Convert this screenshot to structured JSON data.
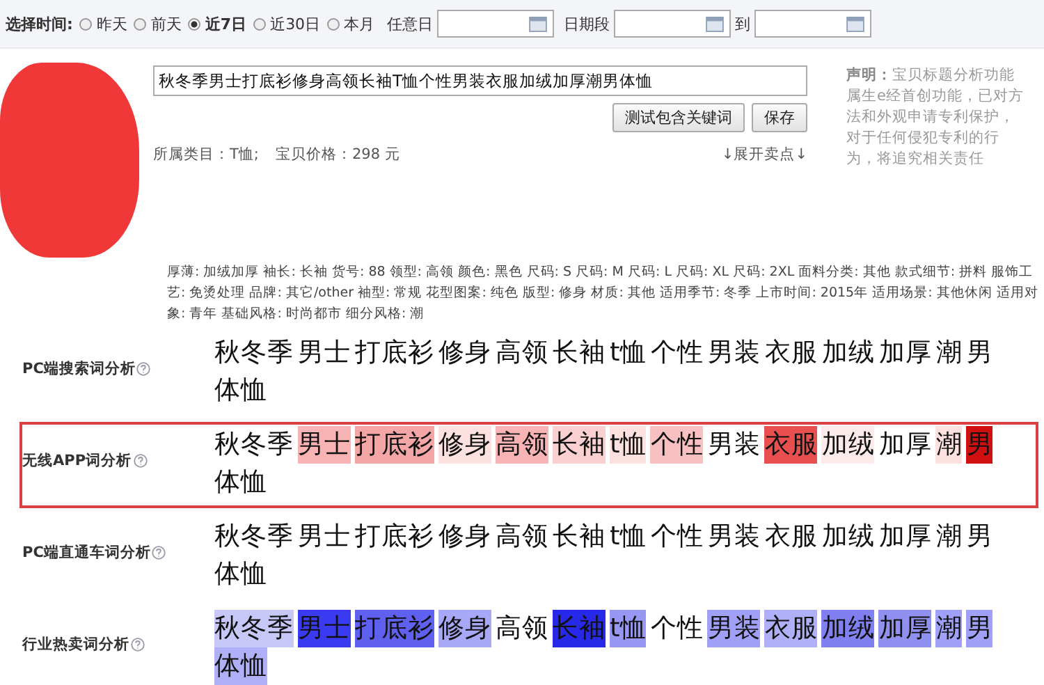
{
  "time_filter": {
    "label": "选择时间:",
    "options": [
      {
        "label": "昨天",
        "selected": false
      },
      {
        "label": "前天",
        "selected": false
      },
      {
        "label": "近7日",
        "selected": true
      },
      {
        "label": "近30日",
        "selected": false
      },
      {
        "label": "本月",
        "selected": false
      }
    ],
    "any_day_label": "任意日",
    "range_label": "日期段",
    "to_label": "到"
  },
  "product": {
    "title": "秋冬季男士打底衫修身高领长袖T恤个性男装衣服加绒加厚潮男体恤",
    "buttons": [
      "测试包含关键词",
      "保存"
    ],
    "category": "所属类目：T恤;",
    "price": "宝贝价格：298 元",
    "expand_link": "↓展开卖点↓",
    "notice_label": "声明：",
    "notice": "宝贝标题分析功能属生e经首创功能，已对方法和外观申请专利保护，对于任何侵犯专利的行为，将追究相关责任",
    "attributes": "厚薄: 加绒加厚  袖长: 长袖  货号: 88  领型: 高领  颜色: 黑色  尺码: S  尺码: M  尺码: L  尺码: XL  尺码: 2XL  面料分类: 其他  款式细节: 拼料  服饰工艺: 免烫处理  品牌: 其它/other  袖型: 常规  花型图案: 纯色  版型: 修身  材质: 其他  适用季节: 冬季  上市时间: 2015年  适用场景: 其他休闲  适用对象: 青年  基础风格: 时尚都市  细分风格: 潮"
  },
  "analysis_rows": [
    {
      "label": "PC端搜索词分析",
      "selected": false,
      "tokens": [
        {
          "text": "秋冬季"
        },
        {
          "text": "男士"
        },
        {
          "text": "打底衫"
        },
        {
          "text": "修身"
        },
        {
          "text": "高领"
        },
        {
          "text": "长袖"
        },
        {
          "text": "t恤"
        },
        {
          "text": "个性"
        },
        {
          "text": "男装"
        },
        {
          "text": "衣服"
        },
        {
          "text": "加绒"
        },
        {
          "text": "加厚"
        },
        {
          "text": "潮"
        },
        {
          "text": "男"
        },
        {
          "text": "体恤"
        }
      ]
    },
    {
      "label": "无线APP词分析",
      "selected": true,
      "tokens": [
        {
          "text": "秋冬季"
        },
        {
          "text": "男士",
          "color": "#f8b4b4"
        },
        {
          "text": "打底衫",
          "color": "#f4a6a6"
        },
        {
          "text": "修身",
          "color": "#fde0e0"
        },
        {
          "text": "高领",
          "color": "#f8b4b4"
        },
        {
          "text": "长袖",
          "color": "#fbd0d0"
        },
        {
          "text": "t恤",
          "color": "#fde0e0"
        },
        {
          "text": "个性",
          "color": "#f8c0c0"
        },
        {
          "text": "男装"
        },
        {
          "text": "衣服",
          "color": "#e85050"
        },
        {
          "text": "加绒",
          "color": "#fdeaea"
        },
        {
          "text": "加厚"
        },
        {
          "text": "潮",
          "color": "#fde0e0"
        },
        {
          "text": "男",
          "color": "#d01010"
        },
        {
          "text": "体恤"
        }
      ]
    },
    {
      "label": "PC端直通车词分析",
      "selected": false,
      "tokens": [
        {
          "text": "秋冬季"
        },
        {
          "text": "男士"
        },
        {
          "text": "打底衫"
        },
        {
          "text": "修身"
        },
        {
          "text": "高领"
        },
        {
          "text": "长袖"
        },
        {
          "text": "t恤"
        },
        {
          "text": "个性"
        },
        {
          "text": "男装"
        },
        {
          "text": "衣服"
        },
        {
          "text": "加绒"
        },
        {
          "text": "加厚"
        },
        {
          "text": "潮"
        },
        {
          "text": "男"
        },
        {
          "text": "体恤"
        }
      ]
    },
    {
      "label": "行业热卖词分析",
      "selected": false,
      "tokens": [
        {
          "text": "秋冬季",
          "color": "#c8c8f8"
        },
        {
          "text": "男士",
          "color": "#3a3af0"
        },
        {
          "text": "打底衫",
          "color": "#6060f0"
        },
        {
          "text": "修身",
          "color": "#a8a8f8"
        },
        {
          "text": "高领"
        },
        {
          "text": "长袖",
          "color": "#2828e8"
        },
        {
          "text": "t恤",
          "color": "#9898f4"
        },
        {
          "text": "个性"
        },
        {
          "text": "男装",
          "color": "#a0a0f8"
        },
        {
          "text": "衣服",
          "color": "#b0b0f8"
        },
        {
          "text": "加绒",
          "color": "#8080f0"
        },
        {
          "text": "加厚",
          "color": "#9090f0"
        },
        {
          "text": "潮",
          "color": "#a0a0f8"
        },
        {
          "text": "男",
          "color": "#a0a0f8"
        },
        {
          "text": "体恤",
          "color": "#b0b0f8"
        }
      ]
    }
  ]
}
